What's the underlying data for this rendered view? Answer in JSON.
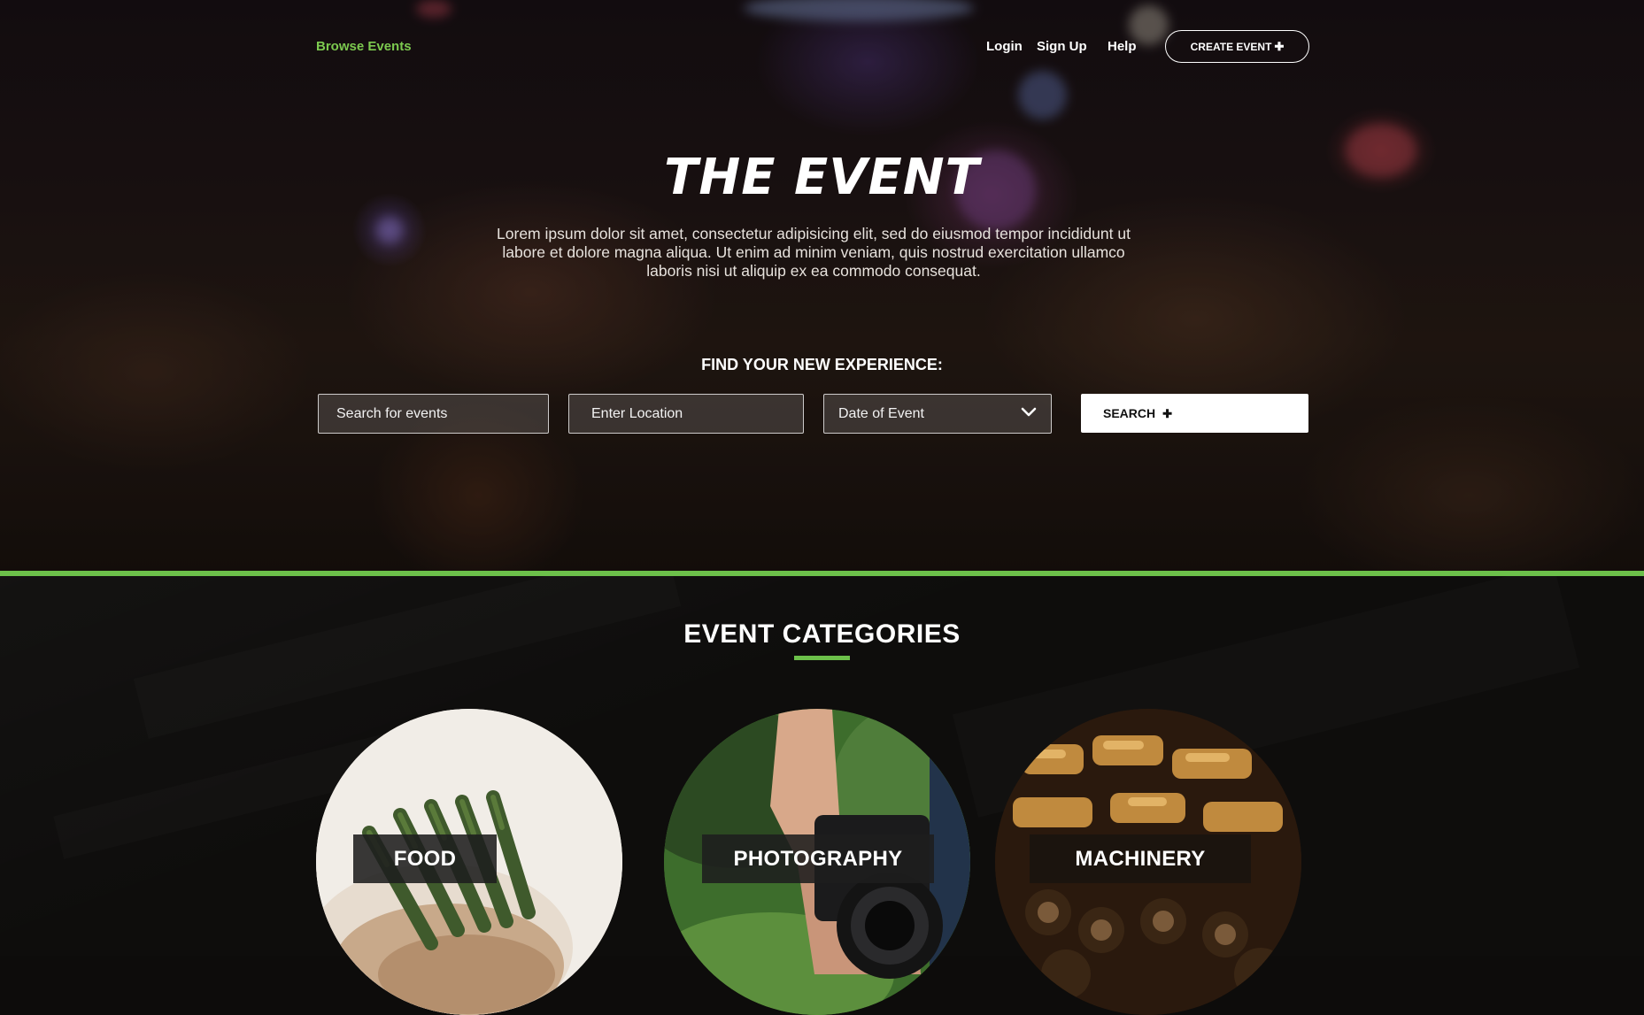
{
  "nav": {
    "browse_label": "Browse Events",
    "login_label": "Login",
    "signup_label": "Sign Up",
    "help_label": "Help",
    "create_label": "CREATE EVENT",
    "create_icon": "plus-icon"
  },
  "hero": {
    "title": "THE EVENT",
    "description": "Lorem ipsum dolor sit amet, consectetur adipisicing elit, sed do eiusmod tempor incididunt ut labore et dolore magna aliqua. Ut enim ad minim veniam, quis nostrud exercitation ullamco laboris nisi ut aliquip ex ea commodo consequat.",
    "find_label": "FIND YOUR NEW EXPERIENCE:"
  },
  "search": {
    "events_placeholder": "Search for events",
    "location_placeholder": "Enter Location",
    "date_value": "Date of Event",
    "date_icon": "chevron-down-icon",
    "button_label": "SEARCH",
    "button_icon": "plus-icon"
  },
  "categories": {
    "title": "EVENT CATEGORIES",
    "items": [
      {
        "label": "FOOD"
      },
      {
        "label": "PHOTOGRAPHY"
      },
      {
        "label": "MACHINERY"
      }
    ]
  },
  "colors": {
    "accent": "#6cc04a",
    "text": "#ffffff",
    "background": "#0e0d0c"
  }
}
